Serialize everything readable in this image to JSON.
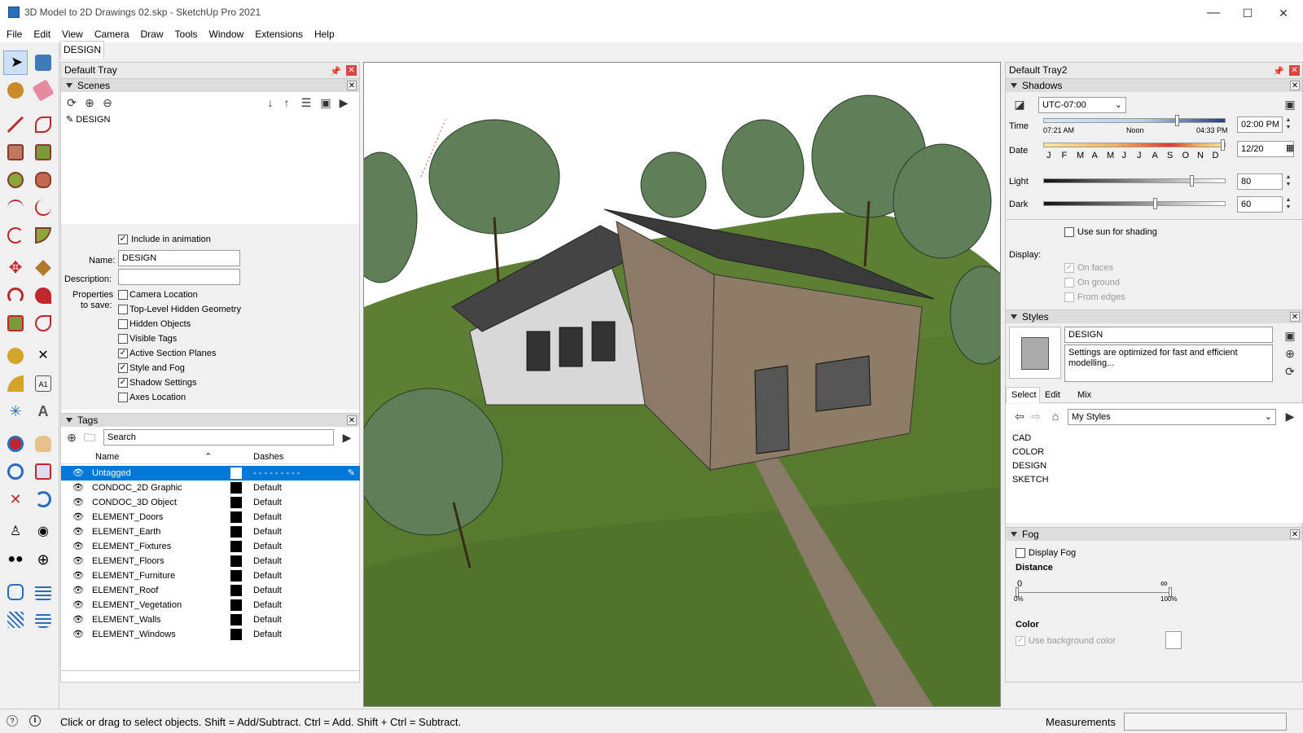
{
  "window": {
    "title": "3D Model to 2D Drawings 02.skp - SketchUp Pro 2021",
    "min": "—",
    "max": "☐",
    "close": "✕"
  },
  "menu": [
    "File",
    "Edit",
    "View",
    "Camera",
    "Draw",
    "Tools",
    "Window",
    "Extensions",
    "Help"
  ],
  "doc_tab": "DESIGN",
  "left_tray": {
    "title": "Default Tray",
    "scenes": {
      "title": "Scenes",
      "items": [
        "DESIGN"
      ],
      "include_in_animation": "Include in animation",
      "name_label": "Name:",
      "name_value": "DESIGN",
      "description_label": "Description:",
      "description_value": "",
      "properties_label": "Properties",
      "properties_label2": "to save:",
      "properties": [
        {
          "label": "Camera Location",
          "checked": false
        },
        {
          "label": "Top-Level Hidden Geometry",
          "checked": false
        },
        {
          "label": "Hidden Objects",
          "checked": false
        },
        {
          "label": "Visible Tags",
          "checked": false
        },
        {
          "label": "Active Section Planes",
          "checked": true
        },
        {
          "label": "Style and Fog",
          "checked": true
        },
        {
          "label": "Shadow Settings",
          "checked": true
        },
        {
          "label": "Axes Location",
          "checked": false
        }
      ]
    },
    "tags": {
      "title": "Tags",
      "search_placeholder": "Search",
      "col_name": "Name",
      "col_dashes": "Dashes",
      "rows": [
        {
          "name": "Untagged",
          "dashes": "- - - - - - - - -",
          "selected": true
        },
        {
          "name": "CONDOC_2D Graphic",
          "dashes": "Default"
        },
        {
          "name": "CONDOC_3D Object",
          "dashes": "Default"
        },
        {
          "name": "ELEMENT_Doors",
          "dashes": "Default"
        },
        {
          "name": "ELEMENT_Earth",
          "dashes": "Default"
        },
        {
          "name": "ELEMENT_Fixtures",
          "dashes": "Default"
        },
        {
          "name": "ELEMENT_Floors",
          "dashes": "Default"
        },
        {
          "name": "ELEMENT_Furniture",
          "dashes": "Default"
        },
        {
          "name": "ELEMENT_Roof",
          "dashes": "Default"
        },
        {
          "name": "ELEMENT_Vegetation",
          "dashes": "Default"
        },
        {
          "name": "ELEMENT_Walls",
          "dashes": "Default"
        },
        {
          "name": "ELEMENT_Windows",
          "dashes": "Default"
        }
      ]
    }
  },
  "right_tray": {
    "title": "Default Tray2",
    "shadows": {
      "title": "Shadows",
      "timezone": "UTC-07:00",
      "time_label": "Time",
      "time_start": "07:21 AM",
      "time_noon": "Noon",
      "time_end": "04:33 PM",
      "time_value": "02:00 PM",
      "date_label": "Date",
      "months": [
        "J",
        "F",
        "M",
        "A",
        "M",
        "J",
        "J",
        "A",
        "S",
        "O",
        "N",
        "D"
      ],
      "date_value": "12/20",
      "light_label": "Light",
      "light_value": "80",
      "dark_label": "Dark",
      "dark_value": "60",
      "use_sun": "Use sun for shading",
      "display_label": "Display:",
      "on_faces": "On faces",
      "on_ground": "On ground",
      "from_edges": "From edges"
    },
    "styles": {
      "title": "Styles",
      "name": "DESIGN",
      "description": "Settings are optimized for fast and efficient modelling...",
      "tabs": [
        "Select",
        "Edit",
        "Mix"
      ],
      "library": "My Styles",
      "list": [
        "CAD",
        "COLOR",
        "DESIGN",
        "SKETCH"
      ]
    },
    "fog": {
      "title": "Fog",
      "display_fog": "Display Fog",
      "distance_label": "Distance",
      "near": "0",
      "far": "∞",
      "near_pct": "0%",
      "far_pct": "100%",
      "color_label": "Color",
      "use_bg": "Use background color"
    }
  },
  "status": {
    "hint": "Click or drag to select objects. Shift = Add/Subtract. Ctrl = Add. Shift + Ctrl = Subtract.",
    "measurements_label": "Measurements",
    "measurements_value": ""
  },
  "colors": {
    "selection": "#0078d7",
    "grass": "#5a7d2e",
    "tree": "#5f7f58"
  }
}
